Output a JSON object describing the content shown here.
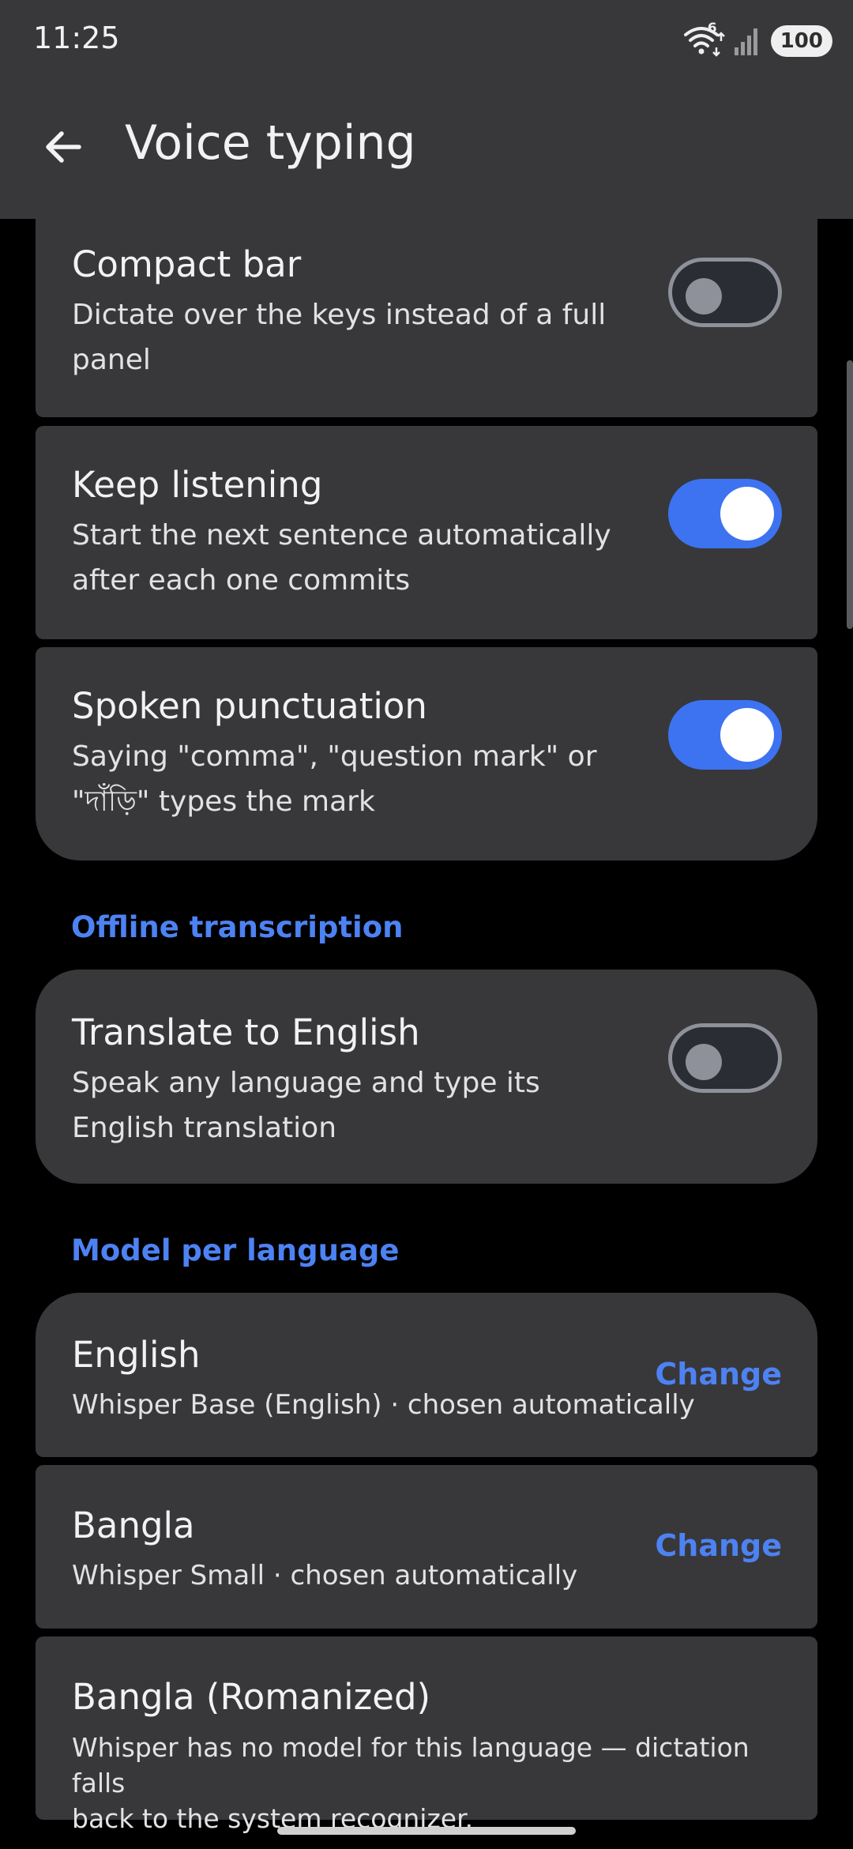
{
  "status_bar": {
    "time": "11:25",
    "battery": "100",
    "wifi_badge": "6"
  },
  "header": {
    "title": "Voice typing",
    "back_icon": "arrow-left-icon"
  },
  "settings": [
    {
      "title": "Compact bar",
      "subtitle_lines": [
        "Dictate over the keys instead of a full",
        "panel"
      ],
      "enabled": false
    },
    {
      "title": "Keep listening",
      "subtitle_lines": [
        "Start the next sentence automatically",
        "after each one commits"
      ],
      "enabled": true
    },
    {
      "title": "Spoken punctuation",
      "subtitle_lines": [
        "Saying \"comma\", \"question mark\" or",
        "\"দাঁড়ি\" types the mark"
      ],
      "enabled": true
    }
  ],
  "offline_section": {
    "header": "Offline transcription",
    "item": {
      "title": "Translate to English",
      "subtitle_lines": [
        "Speak any language and type its",
        "English translation"
      ],
      "enabled": false
    }
  },
  "model_section": {
    "header": "Model per language",
    "items": [
      {
        "title": "English",
        "subtitle": "Whisper Base (English) · chosen automatically",
        "action": "Change"
      },
      {
        "title": "Bangla",
        "subtitle": "Whisper Small · chosen automatically",
        "action": "Change"
      },
      {
        "title": "Bangla (Romanized)",
        "subtitle_lines": [
          "Whisper has no model for this language — dictation falls",
          "back to the system recognizer."
        ]
      }
    ]
  },
  "colors": {
    "accent": "#3D73F0",
    "accent_text": "#4D82F3",
    "card": "#38383B",
    "background": "#000000"
  }
}
